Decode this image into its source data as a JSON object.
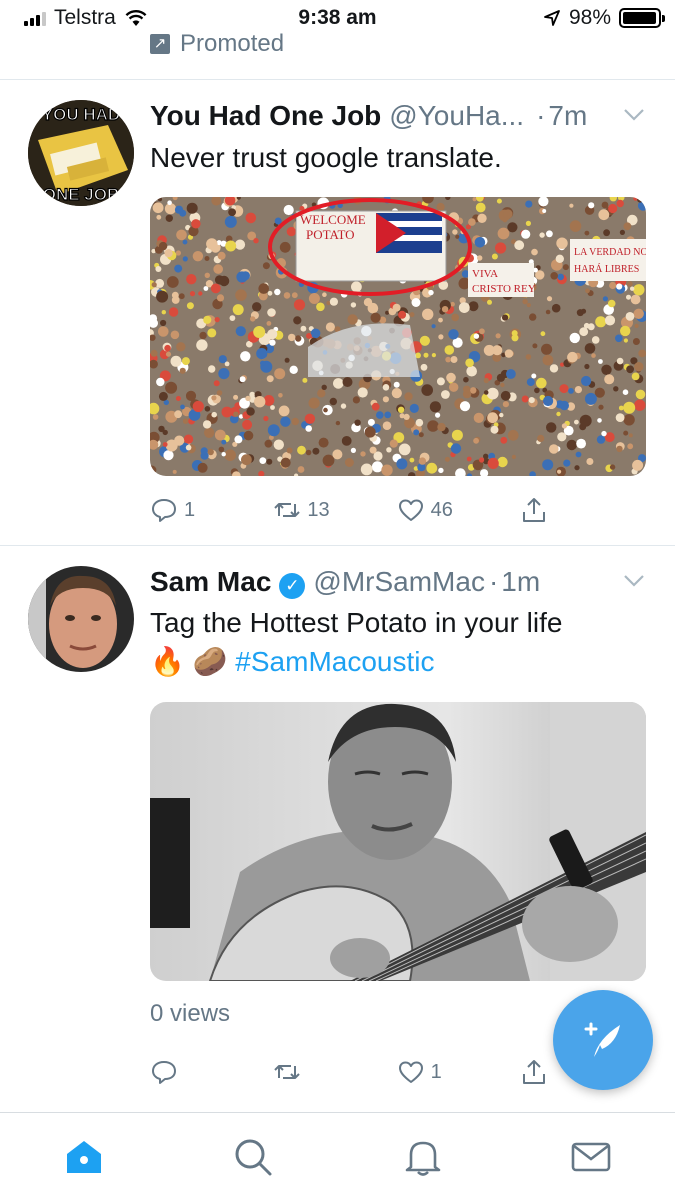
{
  "status_bar": {
    "carrier": "Telstra",
    "time": "9:38 am",
    "battery_percent": "98%",
    "battery_level": 0.98
  },
  "promoted": {
    "label": "Promoted"
  },
  "tweets": [
    {
      "name": "You Had One Job",
      "handle": "@YouHa...",
      "time": "7m",
      "text": "Never trust google translate.",
      "avatar_text_top": "YOU HAD",
      "avatar_text_bottom": "ONE JOB",
      "image_signs": [
        "WELCOME POTATO",
        "VIVA CRISTO REY",
        "LA VERDAD NOS HARA LIBRES"
      ],
      "replies": "1",
      "retweets": "13",
      "likes": "46"
    },
    {
      "name": "Sam Mac",
      "handle": "@MrSamMac",
      "time": "1m",
      "verified": true,
      "text": "Tag the Hottest Potato in your life",
      "emoji": "🔥 🥔",
      "hashtag": "#SamMacoustic",
      "views": "0 views",
      "replies": "",
      "retweets": "",
      "likes": "1"
    }
  ],
  "tabs": [
    {
      "name": "home",
      "active": true
    },
    {
      "name": "search",
      "active": false
    },
    {
      "name": "notifications",
      "active": false
    },
    {
      "name": "messages",
      "active": false
    }
  ],
  "colors": {
    "accent": "#1da1f2",
    "secondary_text": "#657786",
    "fab": "#4aa4ea"
  }
}
